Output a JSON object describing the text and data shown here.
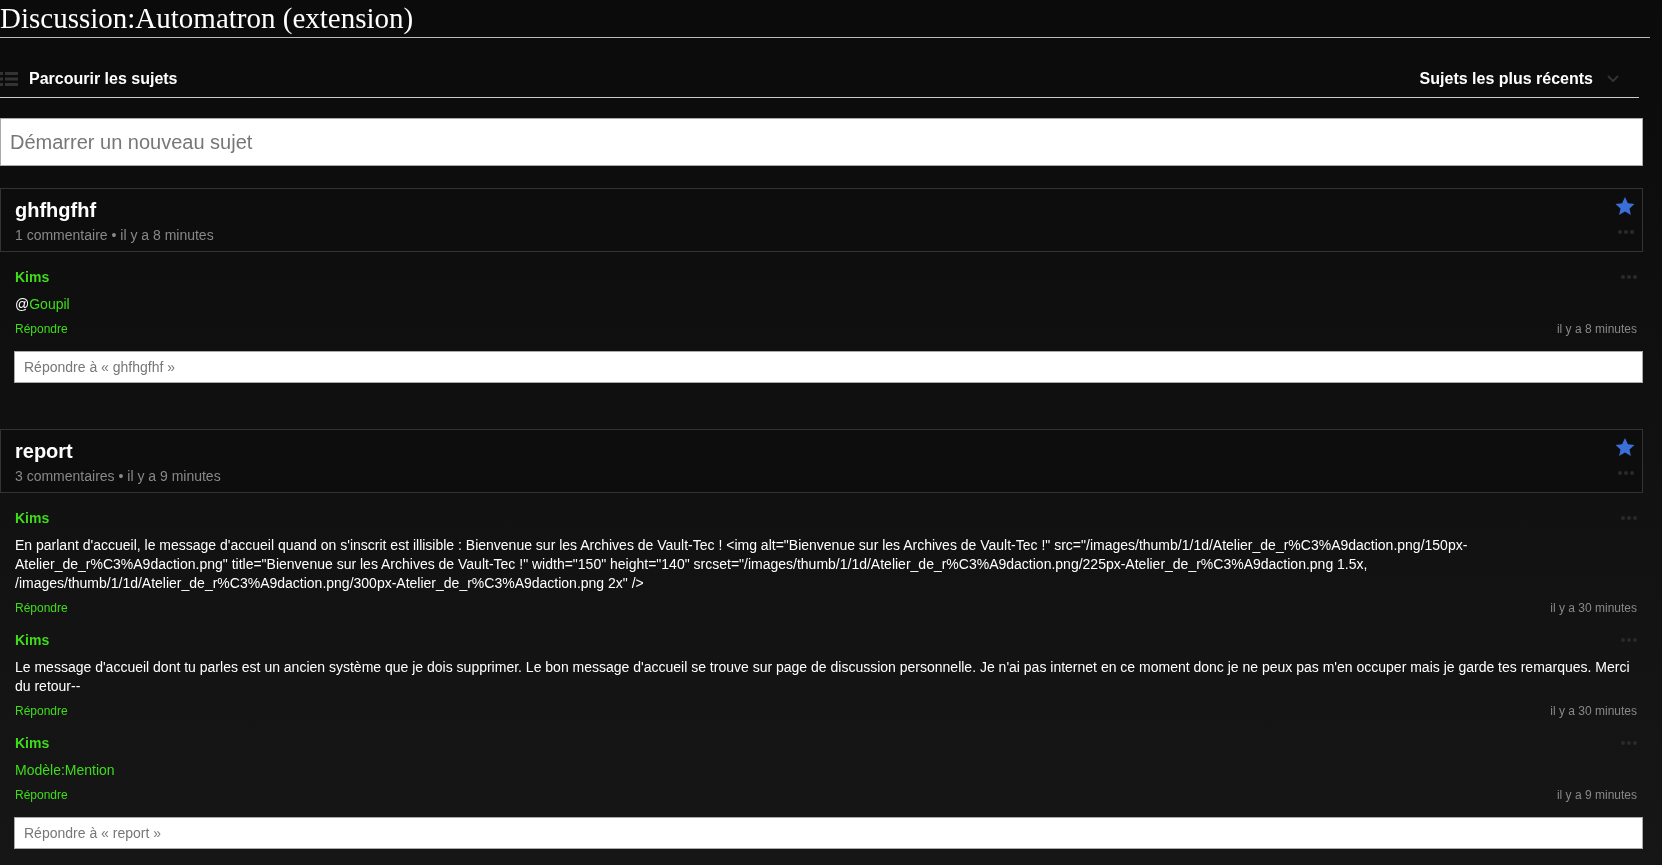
{
  "page_title": "Discussion:Automatron (extension)",
  "nav": {
    "browse": "Parcourir les sujets",
    "sort": "Sujets les plus récents"
  },
  "new_topic": {
    "placeholder": "Démarrer un nouveau sujet"
  },
  "topics": [
    {
      "title": "ghfhgfhf",
      "meta": "1 commentaire • il y a 8 minutes",
      "watched": true,
      "posts": [
        {
          "author": "Kims",
          "body": [
            {
              "kind": "text",
              "text": "@"
            },
            {
              "kind": "link",
              "text": "Goupil"
            }
          ],
          "reply": "Répondre",
          "time": "il y a 8 minutes"
        }
      ],
      "reply_field": {
        "placeholder": "Répondre à « ghfhgfhf »"
      }
    },
    {
      "title": "report",
      "meta": "3 commentaires • il y a 9 minutes",
      "watched": true,
      "posts": [
        {
          "author": "Kims",
          "body": [
            {
              "kind": "text",
              "text": "En parlant d'accueil, le message d'accueil quand on s'inscrit est illisible : Bienvenue sur les Archives de Vault-Tec ! <img alt=\"Bienvenue sur les Archives de Vault-Tec !\" src=\"/images/thumb/1/1d/Atelier_de_r%C3%A9daction.png/150px-Atelier_de_r%C3%A9daction.png\" title=\"Bienvenue sur les Archives de Vault-Tec !\" width=\"150\" height=\"140\" srcset=\"/images/thumb/1/1d/Atelier_de_r%C3%A9daction.png/225px-Atelier_de_r%C3%A9daction.png 1.5x, /images/thumb/1/1d/Atelier_de_r%C3%A9daction.png/300px-Atelier_de_r%C3%A9daction.png 2x\" />"
            }
          ],
          "reply": "Répondre",
          "time": "il y a 30 minutes"
        },
        {
          "author": "Kims",
          "body": [
            {
              "kind": "text",
              "text": "Le message d'accueil dont tu parles est un ancien système que je dois supprimer. Le bon message d'accueil se trouve sur page de discussion personnelle. Je n'ai pas internet en ce moment donc je ne peux pas m'en occuper mais je garde tes remarques. Merci du retour--"
            }
          ],
          "reply": "Répondre",
          "time": "il y a 30 minutes"
        },
        {
          "author": "Kims",
          "body": [
            {
              "kind": "link",
              "text": "Modèle:Mention"
            }
          ],
          "reply": "Répondre",
          "time": "il y a 9 minutes"
        }
      ],
      "reply_field": {
        "placeholder": "Répondre à « report »"
      }
    }
  ]
}
